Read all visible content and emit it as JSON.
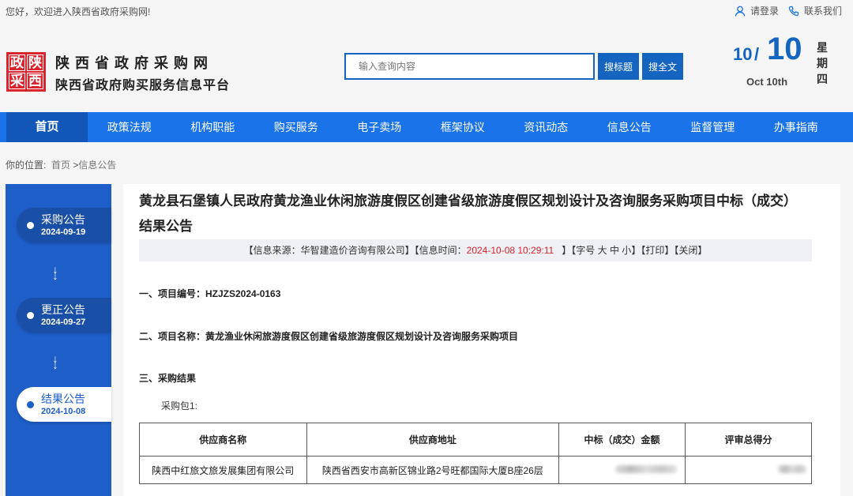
{
  "topbar": {
    "welcome": "您好，欢迎进入陕西省政府采购网!",
    "login": "请登录",
    "contact": "联系我们"
  },
  "header": {
    "logo_chars": [
      "政",
      "陕",
      "采",
      "西"
    ],
    "site_title": "陕西省政府采购网",
    "site_subtitle": "陕西省政府购买服务信息平台",
    "search_placeholder": "输入查询内容",
    "search_title_btn": "搜标题",
    "search_full_btn": "搜全文",
    "date": {
      "month": "10",
      "slash": "/",
      "day": "10",
      "english": "Oct 10th",
      "week_chars": [
        "星",
        "期",
        "四"
      ]
    }
  },
  "nav": {
    "items": [
      "首页",
      "政策法规",
      "机构职能",
      "购买服务",
      "电子卖场",
      "框架协议",
      "资讯动态",
      "信息公告",
      "监督管理",
      "办事指南"
    ],
    "active": "首页"
  },
  "breadcrumb": {
    "label": "你的位置:",
    "home": "首页",
    "sep": ">",
    "current": "信息公告"
  },
  "sidebar": {
    "items": [
      {
        "label": "采购公告",
        "date": "2024-09-19"
      },
      {
        "label": "更正公告",
        "date": "2024-09-27"
      },
      {
        "label": "结果公告",
        "date": "2024-10-08"
      }
    ]
  },
  "article": {
    "title": "黄龙县石堡镇人民政府黄龙渔业休闲旅游度假区创建省级旅游度假区规划设计及咨询服务采购项目中标（成交）结果公告",
    "info": {
      "source_prefix": "【信息来源：华智建造价咨询有限公司】【信息时间：",
      "time": "2024-10-08 10:29:11",
      "time_suffix": "】【字号",
      "size_large": "大",
      "size_mid": "中",
      "size_small": "小",
      "size_suffix": "】",
      "print": "【打印】",
      "close": "【关闭】"
    },
    "section1": "一、项目编号：HZJZS2024-0163",
    "section2": "二、项目名称：黄龙渔业休闲旅游度假区创建省级旅游度假区规划设计及咨询服务采购项目",
    "section3": "三、采购结果",
    "package": "采购包1:",
    "table": {
      "headers": [
        "供应商名称",
        "供应商地址",
        "中标（成交）金额",
        "评审总得分"
      ],
      "rows": [
        [
          "陕西中红旅文旅发展集团有限公司",
          "陕西省西安市高新区锦业路2号旺都国际大厦B座26层"
        ]
      ]
    }
  },
  "colors": {
    "primary": "#1a73e8",
    "nav_active": "#1257b8",
    "sidebar": "#1e5ec8",
    "logo_red": "#d9232d",
    "time_red": "#d9232d"
  }
}
